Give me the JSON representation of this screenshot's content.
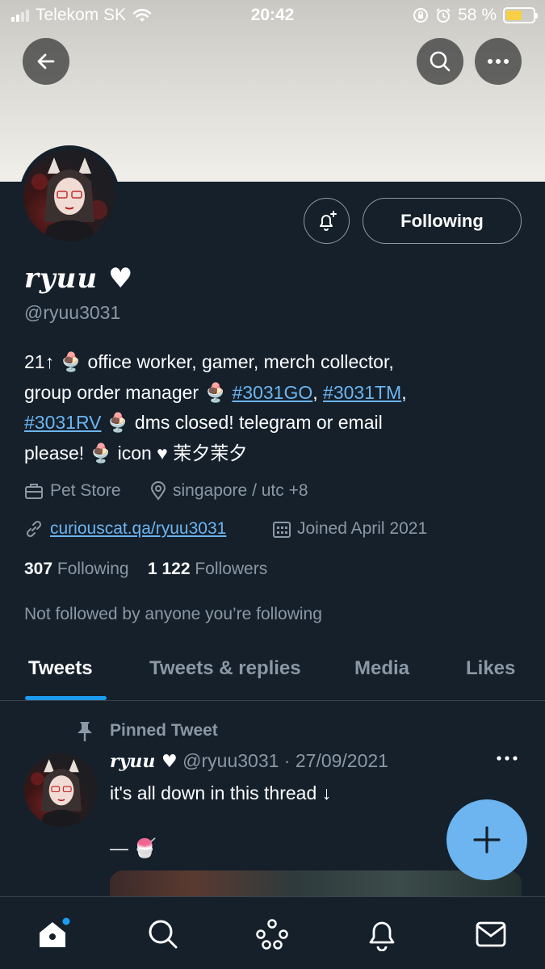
{
  "status_bar": {
    "carrier": "Telekom SK",
    "time": "20:42",
    "battery": "58 %",
    "icons": [
      "signal-icon",
      "wifi-icon",
      "orientation-lock-icon",
      "alarm-icon",
      "battery-icon"
    ]
  },
  "header": {
    "icons": [
      "back-arrow-icon",
      "search-icon",
      "more-icon"
    ]
  },
  "profile": {
    "name": "ryuu ♥",
    "handle": "@ryuu3031",
    "follow_button": "Following",
    "notify_icon": "bell-plus-icon",
    "bio": {
      "line1": "21↑ 🍨 office worker, gamer, merch collector,",
      "line2_start": "group order manager 🍨 ",
      "tag1": "#3031GO",
      "sep1": ", ",
      "tag2": "#3031TM",
      "sep2": ",",
      "tag3": "#3031RV",
      "line3_rest": " 🍨 dms closed! telegram or email",
      "line4": "please! 🍨 icon ♥ 茉夕茉夕"
    },
    "category": "Pet Store",
    "location": "singapore / utc +8",
    "website": "curiouscat.qa/ryuu3031",
    "joined": "Joined April 2021",
    "following_count": "307",
    "following_label": "Following",
    "followers_count": "1 122",
    "followers_label": "Followers",
    "not_followed_text": "Not followed by anyone you’re following"
  },
  "tabs": [
    {
      "label": "Tweets",
      "active": true
    },
    {
      "label": "Tweets & replies",
      "active": false
    },
    {
      "label": "Media",
      "active": false
    },
    {
      "label": "Likes",
      "active": false
    }
  ],
  "pinned_tweet": {
    "pinned_label": "Pinned Tweet",
    "author_name": "ryuu ♥",
    "author_handle": "@ryuu3031",
    "separator": "·",
    "date": "27/09/2021",
    "text_line1": "it's all down in this thread ↓",
    "text_line2": "— 🍧"
  },
  "fab_icon": "compose-plus-icon",
  "bottom_nav": [
    "home-icon",
    "search-icon",
    "spaces-icon",
    "notifications-icon",
    "messages-icon"
  ],
  "colors": {
    "background": "#15202b",
    "accent": "#1d9bf0",
    "link": "#6cb5f0",
    "secondary_text": "#8b98a5",
    "battery_fill": "#f7d046"
  }
}
